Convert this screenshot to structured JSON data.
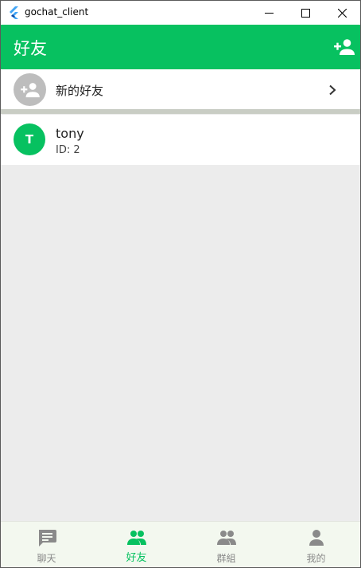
{
  "window": {
    "title": "gochat_client"
  },
  "appbar": {
    "title": "好友"
  },
  "new_friend": {
    "label": "新的好友"
  },
  "friends": [
    {
      "initial": "T",
      "name": "tony",
      "id_text": "ID: 2"
    }
  ],
  "bottom_nav": {
    "active": "好友",
    "items": [
      {
        "label": "聊天",
        "icon": "chat-icon"
      },
      {
        "label": "好友",
        "icon": "people-icon"
      },
      {
        "label": "群組",
        "icon": "group-icon"
      },
      {
        "label": "我的",
        "icon": "person-icon"
      }
    ]
  },
  "colors": {
    "accent": "#07c160",
    "background": "#ececec",
    "inactive": "#8a8a8a",
    "avatar_gray": "#bdbdbd"
  }
}
